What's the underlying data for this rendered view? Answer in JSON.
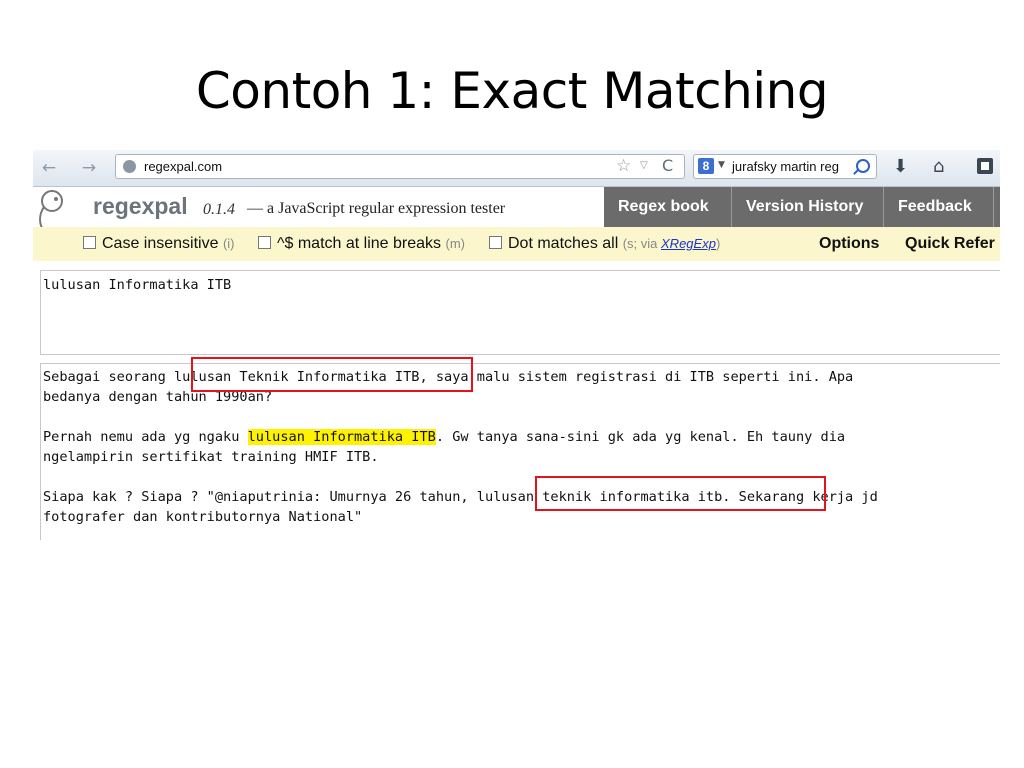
{
  "slide": {
    "title": "Contoh 1: Exact Matching"
  },
  "browser": {
    "url": "regexpal.com",
    "search_text": "jurafsky martin reg",
    "search_engine_letter": "8"
  },
  "app": {
    "logo_word": "regexpal",
    "version": "0.1.4",
    "tagline": "— a JavaScript regular expression tester",
    "tabs": [
      "Regex book",
      "Version History",
      "Feedback"
    ]
  },
  "options": {
    "case_insensitive": {
      "label": "Case insensitive",
      "hint": "(i)",
      "checked": false
    },
    "multiline": {
      "label": "^$ match at line breaks",
      "hint": "(m)",
      "checked": false
    },
    "dotall": {
      "label": "Dot matches all",
      "hint_prefix": "(s; via ",
      "hint_link": "XRegExp",
      "hint_suffix": ")",
      "checked": false
    },
    "options_link": "Options",
    "quick_ref_link": "Quick Refer"
  },
  "pattern": {
    "value": "lulusan Informatika ITB"
  },
  "subject": {
    "p1_line1_pre": "Sebagai seorang ",
    "p1_line1_mid": "lulusan Teknik Informatika ITB",
    "p1_line1_post": ", saya malu sistem registrasi di ITB seperti ini. Apa",
    "p1_line2": "bedanya dengan tahun 1990an?",
    "p2_line1_pre": "Pernah nemu ada yg ngaku ",
    "p2_line1_match": "lulusan Informatika ITB",
    "p2_line1_post": ". Gw tanya sana-sini gk ada yg kenal. Eh tauny dia",
    "p2_line2": "ngelampirin sertifikat training HMIF ITB.",
    "p3_line1_pre": "Siapa kak ? Siapa ? \"@niaputrinia: Umurnya 26 tahun, ",
    "p3_line1_mid": "lulusan teknik informatika itb",
    "p3_line1_post": ". Sekarang kerja jd",
    "p3_line2": "fotografer dan kontributornya National\""
  },
  "colors": {
    "match_highlight": "#fff200",
    "annotation_box": "#e8101a",
    "options_bar": "#fbf6cc",
    "tab_bg": "#6b6b6b"
  }
}
